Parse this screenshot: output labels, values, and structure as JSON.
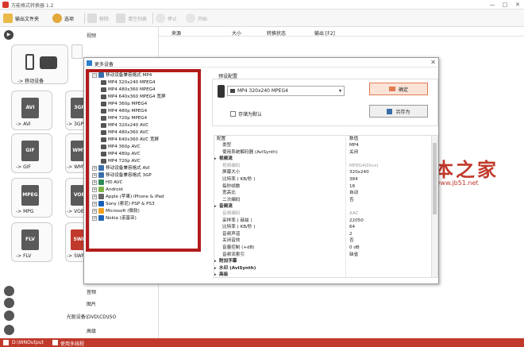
{
  "window": {
    "title": "万能格式转换器 1.2",
    "min": "—",
    "max": "□",
    "close": "✕"
  },
  "toolbar": {
    "add_folder": "输出文件夹",
    "options": "选项",
    "remove": "移除",
    "clear_list": "清空列表",
    "stop": "停止",
    "start": "开始"
  },
  "sidebar": {
    "video": "视频",
    "audio": "音频",
    "image": "图片",
    "rom": "光驱设备\\DVD\\CD\\ISO",
    "advanced": "高级",
    "tiles": [
      {
        "label": "-> 移动设备",
        "icon": ""
      },
      {
        "label": "-> AVI",
        "icon": "AVI"
      },
      {
        "label": "-> 3GP",
        "icon": "3GP"
      },
      {
        "label": "-> GIF",
        "icon": "GIF"
      },
      {
        "label": "-> WMV",
        "icon": "WMV"
      },
      {
        "label": "-> MPG",
        "icon": "MPEG"
      },
      {
        "label": "-> VOB",
        "icon": "VOB"
      },
      {
        "label": "-> FLV",
        "icon": "FLV"
      },
      {
        "label": "-> SWF",
        "icon": "SWF"
      }
    ]
  },
  "filelist": {
    "columns": [
      "来源",
      "大小",
      "转换状态",
      "输出 [F2]"
    ]
  },
  "statusbar": {
    "output": "D:\\WNOutput",
    "multithread": "使用多线程"
  },
  "dialog": {
    "title": "更多设备",
    "tree": {
      "root": "移动设备兼容格式 MP4",
      "mp4_items": [
        "MP4 320x240 MPEG4",
        "MP4 480x360 MPEG4",
        "MP4 640x360 MPEG4 宽屏",
        "MP4 360p MPEG4",
        "MP4 480p MPEG4",
        "MP4 720p MPEG4",
        "MP4 320x240 AVC",
        "MP4 480x360 AVC",
        "MP4 640x360 AVC 宽屏",
        "MP4 360p AVC",
        "MP4 480p AVC",
        "MP4 720p AVC"
      ],
      "other_groups": [
        "移动设备兼容格式 AVI",
        "移动设备兼容格式 3GP",
        "HD AVC",
        "Android",
        "Apple (苹果) iPhone & iPad",
        "Sony (索尼) PSP & PS3",
        "Microsoft (微软)",
        "Nokia (诺基亚)"
      ]
    },
    "preset_legend": "预设配置",
    "preset_value": "MP4 320x240 MPEG4",
    "ok": "确定",
    "save_as": "另存为",
    "save_default": "存储为默认",
    "props_header": {
      "k": "配置",
      "v": "数值"
    },
    "props": [
      {
        "k": "类型",
        "v": "MP4",
        "kind": "row"
      },
      {
        "k": "使用系统解码器 (AviSynth)",
        "v": "关闭",
        "kind": "row"
      },
      {
        "k": "视频流",
        "v": "",
        "kind": "sec"
      },
      {
        "k": "视频编码",
        "v": "MPEG4(Divx)",
        "kind": "dim"
      },
      {
        "k": "屏幕大小",
        "v": "320x240",
        "kind": "row"
      },
      {
        "k": "比特率 ( KB/秒 )",
        "v": "384",
        "kind": "row"
      },
      {
        "k": "每秒帧数",
        "v": "18",
        "kind": "row"
      },
      {
        "k": "宽高比",
        "v": "自动",
        "kind": "row"
      },
      {
        "k": "二次编码",
        "v": "否",
        "kind": "row"
      },
      {
        "k": "音频流",
        "v": "",
        "kind": "sec"
      },
      {
        "k": "音频编码",
        "v": "AAC",
        "kind": "dim"
      },
      {
        "k": "采样率 ( 赫兹 )",
        "v": "22050",
        "kind": "row"
      },
      {
        "k": "比特率 ( KB/秒 )",
        "v": "64",
        "kind": "row"
      },
      {
        "k": "音频声道",
        "v": "2",
        "kind": "row"
      },
      {
        "k": "关闭音效",
        "v": "否",
        "kind": "row"
      },
      {
        "k": "音量控制 (+dB)",
        "v": "0 dB",
        "kind": "row"
      },
      {
        "k": "音频流索引",
        "v": "缺省",
        "kind": "row"
      },
      {
        "k": "附加字幕",
        "v": "",
        "kind": "sec"
      },
      {
        "k": "水印 (AviSynth)",
        "v": "",
        "kind": "sec"
      },
      {
        "k": "高级",
        "v": "",
        "kind": "sec"
      }
    ]
  },
  "watermark": {
    "text": "脚本之家",
    "url": "www.jb51.net"
  },
  "colors": {
    "accent": "#c0392b",
    "highlight_border": "#b31b1b"
  }
}
